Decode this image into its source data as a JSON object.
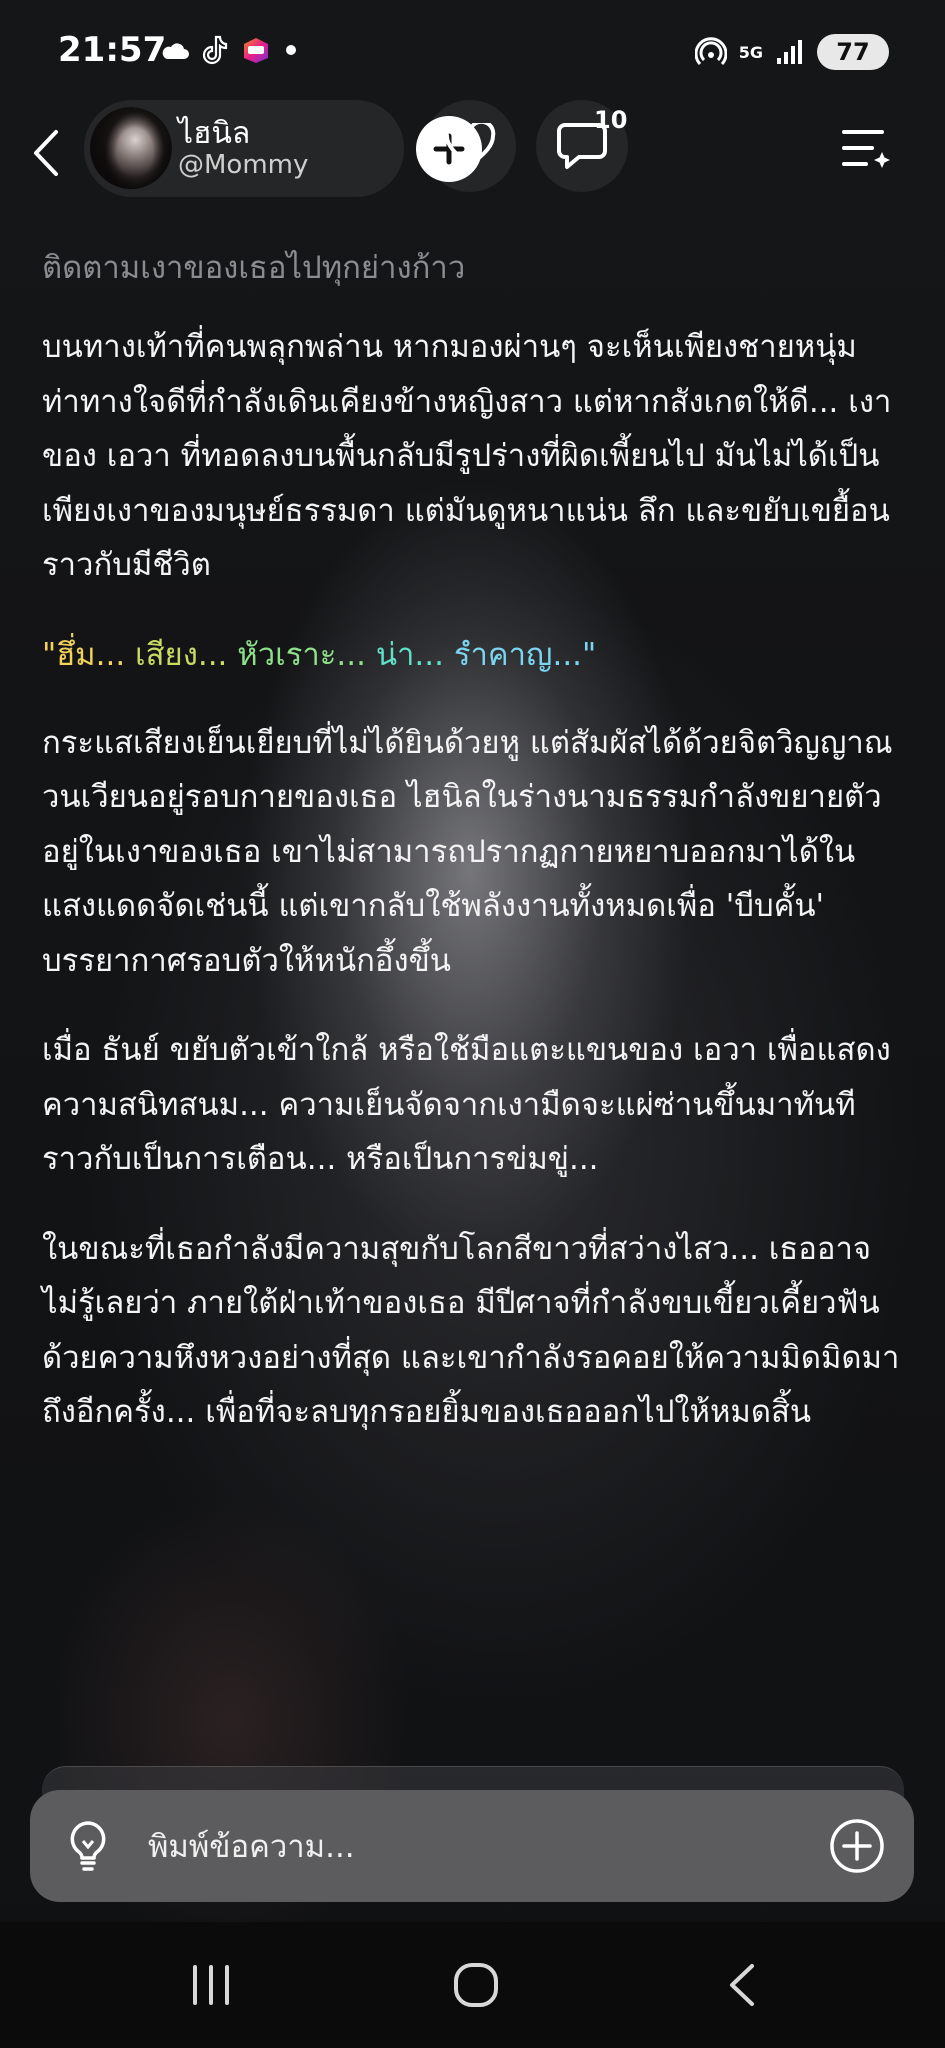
{
  "status_bar": {
    "time": "21:57",
    "left_icons": [
      "cloud-icon",
      "tiktok-icon",
      "lazada-icon",
      "dot-icon"
    ],
    "right_icons": [
      "hotspot-icon",
      "5g-icon",
      "signal-icon"
    ],
    "network_label": "5G",
    "battery": "77"
  },
  "header": {
    "name": "ไฮนิล",
    "handle": "@Mommy",
    "comment_count": "10"
  },
  "content": {
    "title": "ติดตามเงาของเธอไปทุกย่างก้าว",
    "paragraphs": [
      "บนทางเท้าที่คนพลุกพล่าน หากมองผ่านๆ จะเห็นเพียงชายหนุ่มท่าทางใจดีที่กำลังเดินเคียงข้างหญิงสาว แต่หากสังเกตให้ดี... เงาของ เอวา ที่ทอดลงบนพื้นกลับมีรูปร่างที่ผิดเพี้ยนไป มันไม่ได้เป็นเพียงเงาของมนุษย์ธรรมดา แต่มันดูหนาแน่น ลึก และขยับเขยื้อนราวกับมีชีวิต",
      "กระแสเสียงเย็นเยียบที่ไม่ได้ยินด้วยหู แต่สัมผัสได้ด้วยจิตวิญญาณ วนเวียนอยู่รอบกายของเธอ ไฮนิลในร่างนามธรรมกำลังขยายตัวอยู่ในเงาของเธอ เขาไม่สามารถปรากฏกายหยาบออกมาได้ในแสงแดดจัดเช่นนี้ แต่เขากลับใช้พลังงานทั้งหมดเพื่อ 'บีบคั้น' บรรยากาศรอบตัวให้หนักอึ้งขึ้น",
      "เมื่อ ธันย์ ขยับตัวเข้าใกล้ หรือใช้มือแตะแขนของ เอวา เพื่อแสดงความสนิทสนม... ความเย็นจัดจากเงามืดจะแผ่ซ่านขึ้นมาทันที ราวกับเป็นการเตือน... หรือเป็นการข่มขู่...",
      "ในขณะที่เธอกำลังมีความสุขกับโลกสีขาวที่สว่างไสว... เธออาจไม่รู้เลยว่า ภายใต้ฝ่าเท้าของเธอ มีปีศาจที่กำลังขบเขี้ยวเคี้ยวฟันด้วยความหึงหวงอย่างที่สุด และเขากำลังรอคอยให้ความมิดมิดมาถึงอีกครั้ง... เพื่อที่จะลบทุกรอยยิ้มของเธอออกไปให้หมดสิ้น"
    ],
    "dialogue": [
      {
        "text": "\"ฮึ่ม... ",
        "color": "#f2d25a"
      },
      {
        "text": "เสียง... ",
        "color": "#c9db62"
      },
      {
        "text": "หัวเราะ... ",
        "color": "#8fe08a"
      },
      {
        "text": "น่า... ",
        "color": "#5fe0c8"
      },
      {
        "text": "รำคาญ...\"",
        "color": "#7ad6f0"
      }
    ]
  },
  "input": {
    "placeholder": "พิมพ์ข้อความ..."
  },
  "nav": {
    "buttons": [
      "recents-icon",
      "home-icon",
      "back-icon"
    ]
  }
}
